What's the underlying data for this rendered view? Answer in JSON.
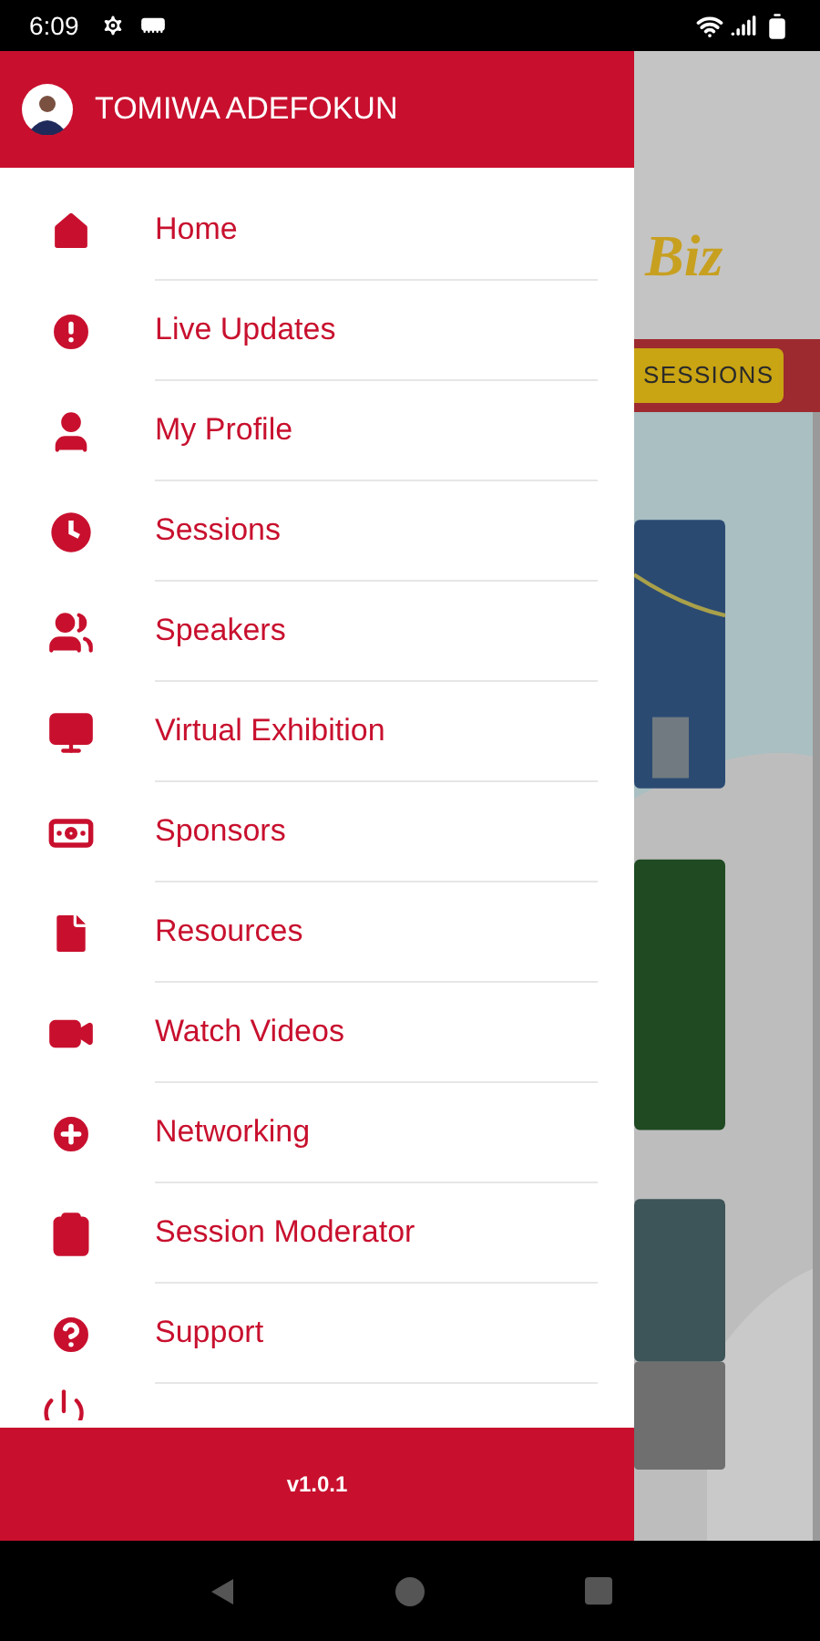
{
  "status_bar": {
    "time": "6:09"
  },
  "drawer": {
    "user_name": "TOMIWA ADEFOKUN",
    "items": [
      {
        "label": "Home"
      },
      {
        "label": "Live Updates"
      },
      {
        "label": "My Profile"
      },
      {
        "label": "Sessions"
      },
      {
        "label": "Speakers"
      },
      {
        "label": "Virtual Exhibition"
      },
      {
        "label": "Sponsors"
      },
      {
        "label": "Resources"
      },
      {
        "label": "Watch Videos"
      },
      {
        "label": "Networking"
      },
      {
        "label": "Session Moderator"
      },
      {
        "label": "Support"
      }
    ],
    "version": "v1.0.1"
  },
  "background": {
    "logo": "Biz",
    "button": "SESSIONS"
  }
}
